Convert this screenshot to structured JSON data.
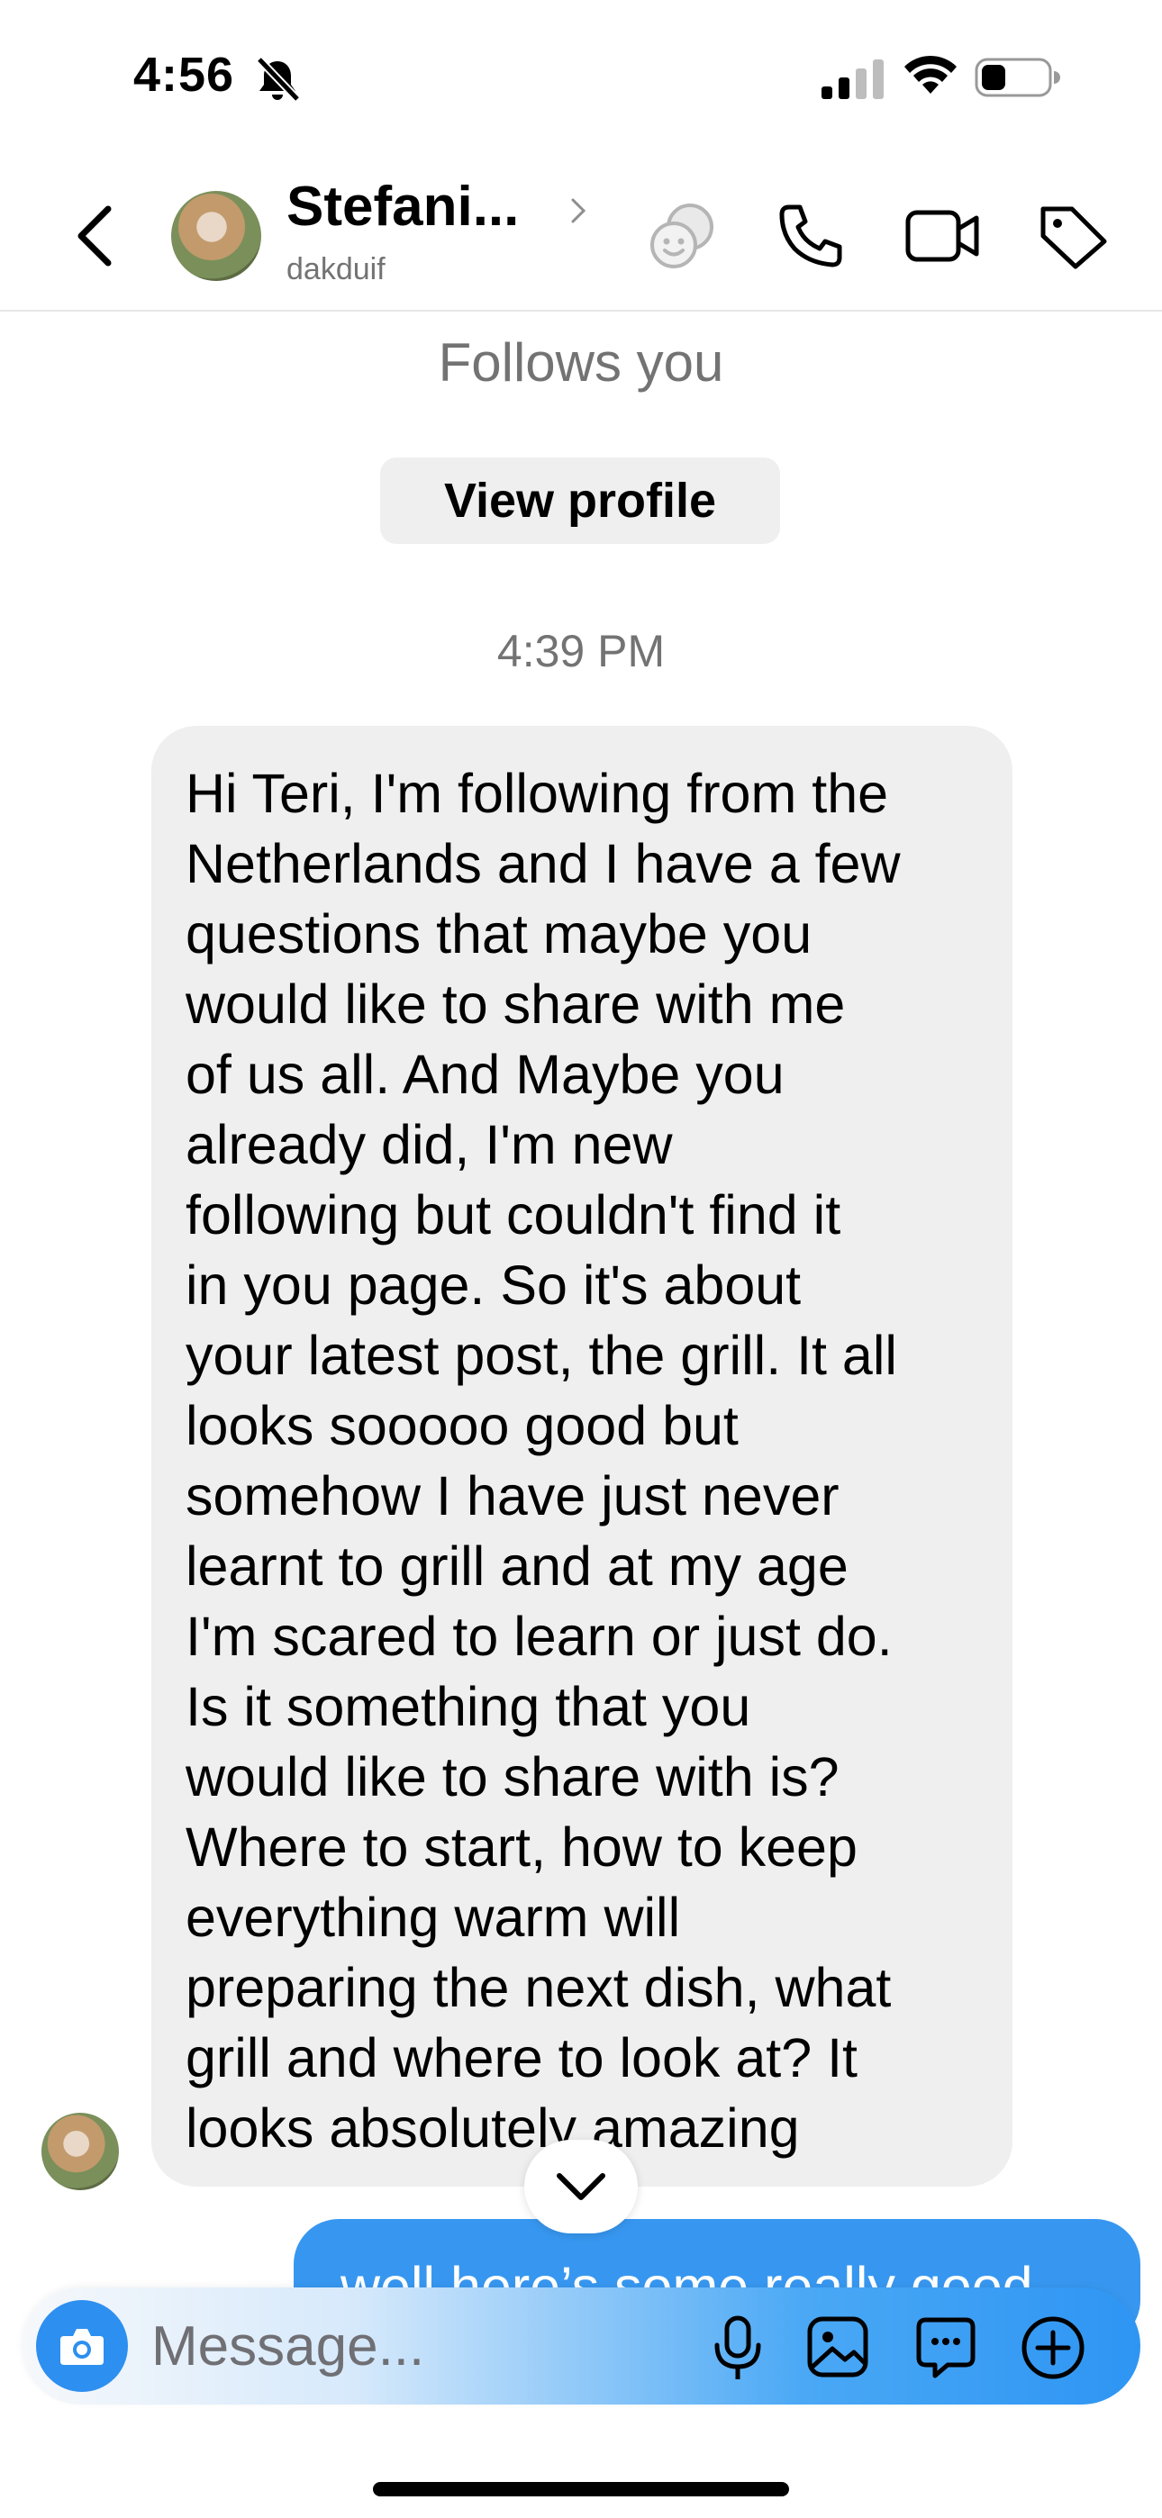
{
  "status_bar": {
    "time": "4:56"
  },
  "header": {
    "contact_name": "Stefani...",
    "username": "dakduif"
  },
  "thread": {
    "follows_text": "Follows you",
    "view_profile_label": "View profile",
    "timestamp": "4:39 PM",
    "incoming_message": "Hi Teri, I'm following from the\nNetherlands and I have a few\nquestions that maybe you\nwould like to share with me\nof us all. And Maybe you\nalready did, I'm new\nfollowing but couldn't find it\nin you page. So it's about\nyour latest post, the grill. It all\nlooks sooooo good but\nsomehow I have just never\nlearnt to grill and at my age\nI'm scared to learn or just do.\nIs it something that you\nwould like to share with is?\nWhere to start, how to keep\neverything warm will\npreparing the next dish, what\ngrill and where to look at? It\nlooks absolutely amazing",
    "outgoing_message": "well here’s some really good"
  },
  "composer": {
    "placeholder": "Message..."
  },
  "colors": {
    "outgoing_bubble": "#3797f0",
    "incoming_bubble": "#efefef",
    "secondary_text": "#737373",
    "camera_button": "#2d8ff0"
  },
  "icons": {
    "status": [
      "bell-slash-icon",
      "signal-icon",
      "wifi-icon",
      "battery-icon"
    ],
    "header": [
      "back-chevron-icon",
      "chevron-right-icon",
      "theme-icon",
      "phone-icon",
      "video-camera-icon",
      "tag-icon"
    ],
    "composer": [
      "camera-icon",
      "microphone-icon",
      "gallery-icon",
      "sticker-icon",
      "plus-circle-icon"
    ]
  }
}
